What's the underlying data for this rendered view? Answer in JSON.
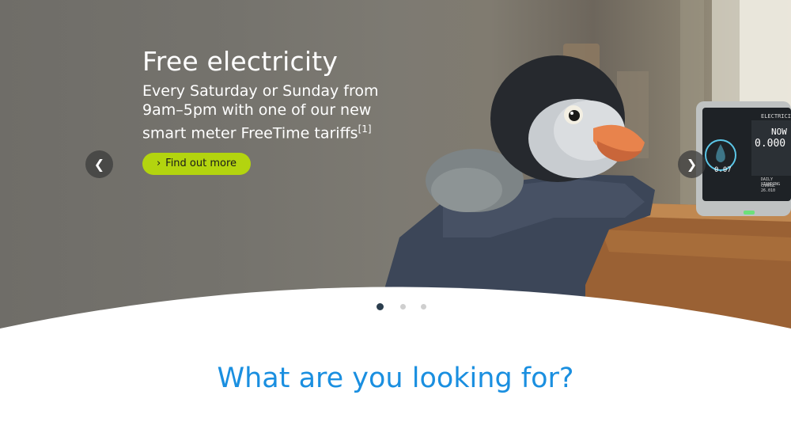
{
  "hero": {
    "title": "Free electricity",
    "subtitle_line1": "Every Saturday or Sunday from",
    "subtitle_line2": "9am–5pm with one of our new",
    "subtitle_line3": "smart meter FreeTime tariffs",
    "footnote": "[1]",
    "cta_label": "Find out more",
    "cta_icon": "chevron-right-icon",
    "prev_icon": "chevron-left-icon",
    "next_icon": "chevron-right-icon"
  },
  "meter": {
    "label": "ELECTRICITY",
    "now": "NOW",
    "value": "0.000",
    "left_value": "0.07",
    "footer_line1": "DAILY STANDING",
    "footer_line2": "CHARGE 26.010"
  },
  "carousel": {
    "slide_count": 3,
    "active_index": 0
  },
  "section": {
    "heading": "What are you looking for?"
  },
  "colors": {
    "accent_green": "#b3d40f",
    "heading_blue": "#1a8fe0",
    "active_dot": "#2c3e4e",
    "inactive_dot": "#cfcfcf"
  }
}
